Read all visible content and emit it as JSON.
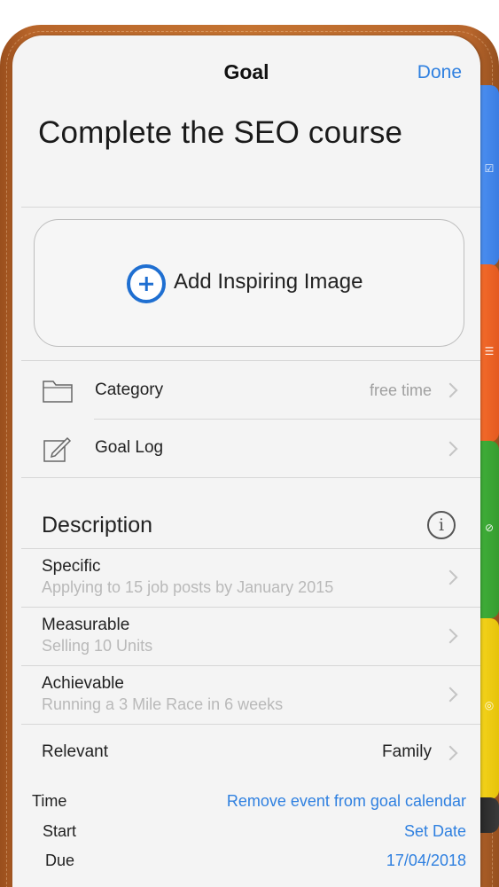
{
  "nav": {
    "title": "Goal",
    "done_label": "Done"
  },
  "goal": {
    "title": "Complete the SEO course"
  },
  "image_picker": {
    "label": "Add Inspiring Image"
  },
  "details": {
    "category": {
      "label": "Category",
      "value": "free time"
    },
    "goal_log": {
      "label": "Goal Log"
    }
  },
  "description": {
    "heading": "Description",
    "specific": {
      "label": "Specific",
      "placeholder": "Applying to 15 job posts by January 2015"
    },
    "measurable": {
      "label": "Measurable",
      "placeholder": "Selling 10 Units"
    },
    "achievable": {
      "label": "Achievable",
      "placeholder": "Running a 3 Mile Race in 6 weeks"
    },
    "relevant": {
      "label": "Relevant",
      "value": "Family"
    }
  },
  "time": {
    "label": "Time",
    "action": "Remove event from goal calendar",
    "start_label": "Start",
    "start_value": "Set Date",
    "due_label": "Due",
    "due_value": "17/04/2018"
  },
  "colors": {
    "accent": "#2f80e0",
    "leather": "#c47331",
    "tab_blue": "#4a8ef0",
    "tab_orange": "#f26a2a",
    "tab_green": "#3fae38",
    "tab_yellow": "#f3d21a"
  },
  "icons": [
    "folder-icon",
    "edit-icon",
    "plus-circle-icon",
    "info-icon",
    "chevron-right-icon",
    "checkbox-icon",
    "list-icon",
    "compass-icon",
    "target-icon"
  ]
}
